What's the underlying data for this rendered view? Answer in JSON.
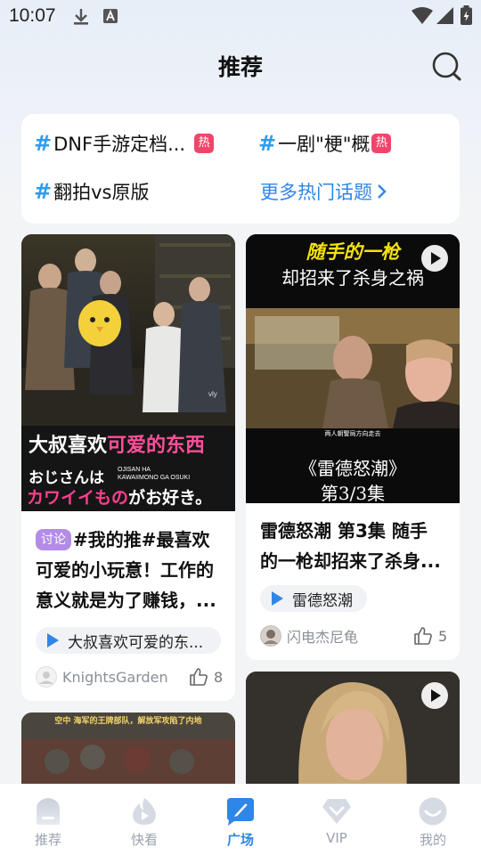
{
  "status_bar": {
    "time": "10:07"
  },
  "header": {
    "title": "推荐"
  },
  "topics": {
    "items": [
      {
        "hash": "#",
        "text": "DNF手游定档...",
        "badge": "热"
      },
      {
        "hash": "#",
        "text": "一剧\"梗\"概",
        "badge": "热"
      },
      {
        "hash": "#",
        "text": "翻拍vs原版"
      }
    ],
    "more": "更多热门话题"
  },
  "cards": [
    {
      "title_overlay": "大叔喜欢可爱的东西",
      "title_overlay_highlight": "可爱的东西",
      "title_overlay_plain": "大叔喜欢",
      "sub_overlay_1": "おじさんは",
      "sub_overlay_small_1": "OJISAN HA",
      "sub_overlay_small_2": "KAWAIIMONO GA OSUKI",
      "sub_overlay_2a": "カワイイもの",
      "sub_overlay_2b": "がお好き。",
      "tag": "讨论",
      "text": "#我的推#最喜欢可爱的小玩意！工作的意义就是为了赚钱，...",
      "text_l1": "#我的推#最喜欢",
      "text_l2": "可爱的小玩意！工作的",
      "text_l3": "意义就是为了赚钱，...",
      "chip": "大叔喜欢可爱的东...",
      "author": "KnightsGarden",
      "likes": "8"
    },
    {
      "overlay_top1": "随手的一枪",
      "overlay_top2": "却招来了杀身之祸",
      "overlay_caption": "两人朝警局方向走去",
      "overlay_bottom1": "《雷德怒潮》",
      "overlay_bottom2": "第3/3集",
      "text_l1": "雷德怒潮 第3集 随手",
      "text_l2": "的一枪却招来了杀身...",
      "chip": "雷德怒潮",
      "author": "闪电杰尼龟",
      "likes": "5"
    },
    {
      "overlay_top": "空中  海军的王牌部队，解放军攻陷了内地"
    },
    {}
  ],
  "nav": {
    "items": [
      {
        "label": "推荐"
      },
      {
        "label": "快看"
      },
      {
        "label": "广场"
      },
      {
        "label": "VIP"
      },
      {
        "label": "我的"
      }
    ],
    "active_color": "#2f86e6",
    "inactive_color": "#9aa2ad"
  },
  "colors": {
    "accent": "#2f86e6",
    "hot_badge": "#f0456b",
    "hash": "#2f9ce9",
    "discuss_tag": "#b38ce6"
  }
}
